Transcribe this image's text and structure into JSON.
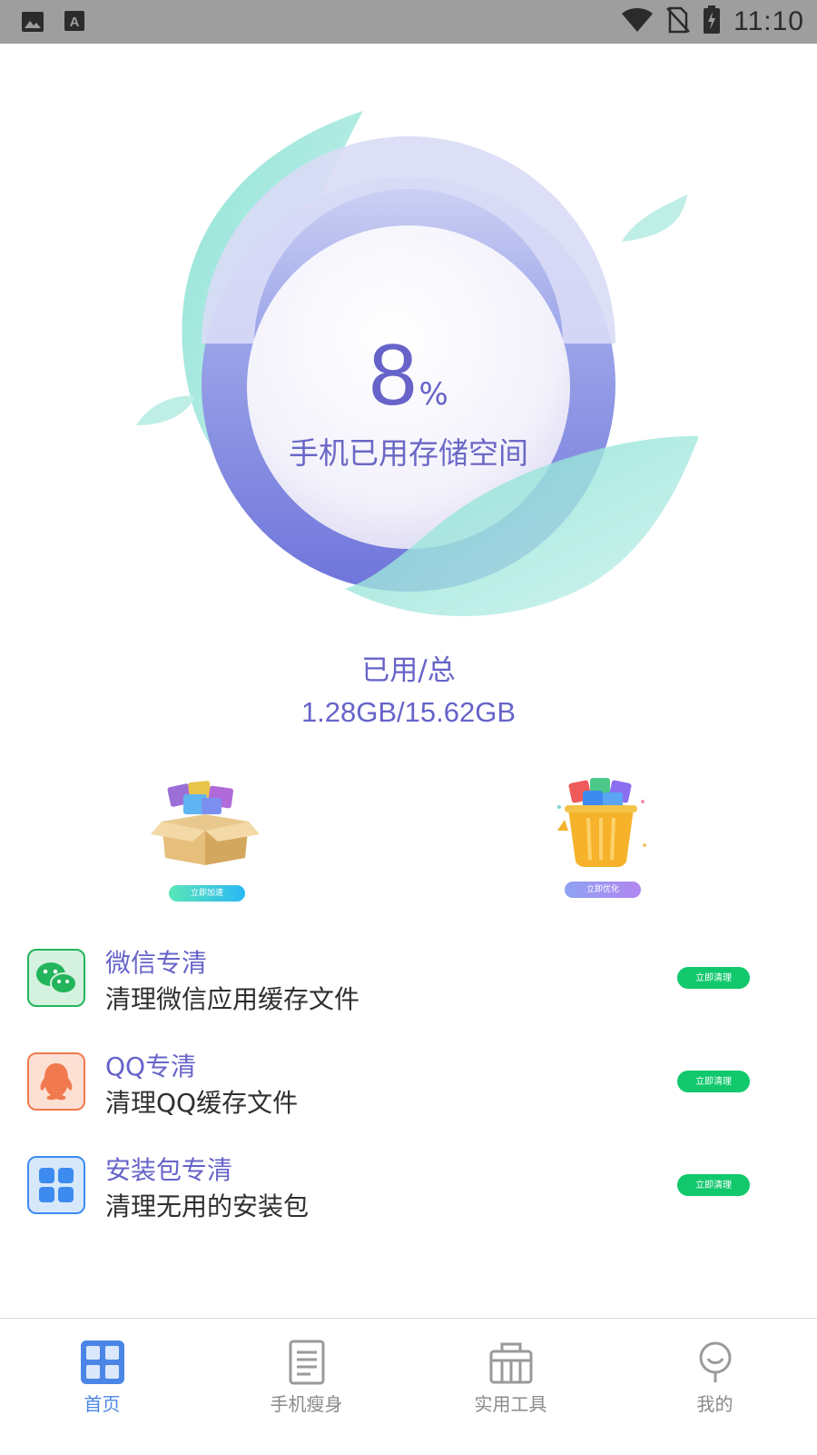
{
  "status_bar": {
    "time": "11:10",
    "icons_left": [
      "image-icon",
      "font-a-icon"
    ],
    "icons_right": [
      "wifi-icon",
      "no-sim-icon",
      "battery-charging-icon"
    ]
  },
  "storage": {
    "percent": "8",
    "percent_sign": "%",
    "label": "手机已用存储空间",
    "usage_title": "已用/总",
    "usage_value": "1.28GB/15.62GB"
  },
  "actions": [
    {
      "name": "accelerate",
      "icon": "box-apps-icon",
      "label": "立即加速"
    },
    {
      "name": "optimize",
      "icon": "trash-bin-icon",
      "label": "立即优化"
    }
  ],
  "clean_items": [
    {
      "name": "wechat",
      "icon": "wechat-icon",
      "title": "微信专清",
      "desc": "清理微信应用缓存文件",
      "button": "立即清理"
    },
    {
      "name": "qq",
      "icon": "qq-penguin-icon",
      "title": "QQ专清",
      "desc": "清理QQ缓存文件",
      "button": "立即清理"
    },
    {
      "name": "apk",
      "icon": "apps-grid-icon",
      "title": "安装包专清",
      "desc": "清理无用的安装包",
      "button": "立即清理"
    }
  ],
  "tabs": [
    {
      "name": "home",
      "icon": "grid-icon",
      "label": "首页",
      "active": true
    },
    {
      "name": "slim",
      "icon": "document-icon",
      "label": "手机瘦身",
      "active": false
    },
    {
      "name": "tools",
      "icon": "toolbox-icon",
      "label": "实用工具",
      "active": false
    },
    {
      "name": "mine",
      "icon": "person-icon",
      "label": "我的",
      "active": false
    }
  ],
  "colors": {
    "accent_purple": "#6663c9",
    "teal_leaf": "#8fe3d6",
    "clean_green": "#12c86c",
    "tab_active": "#4b86e6",
    "status_bar": "#9e9e9e"
  }
}
